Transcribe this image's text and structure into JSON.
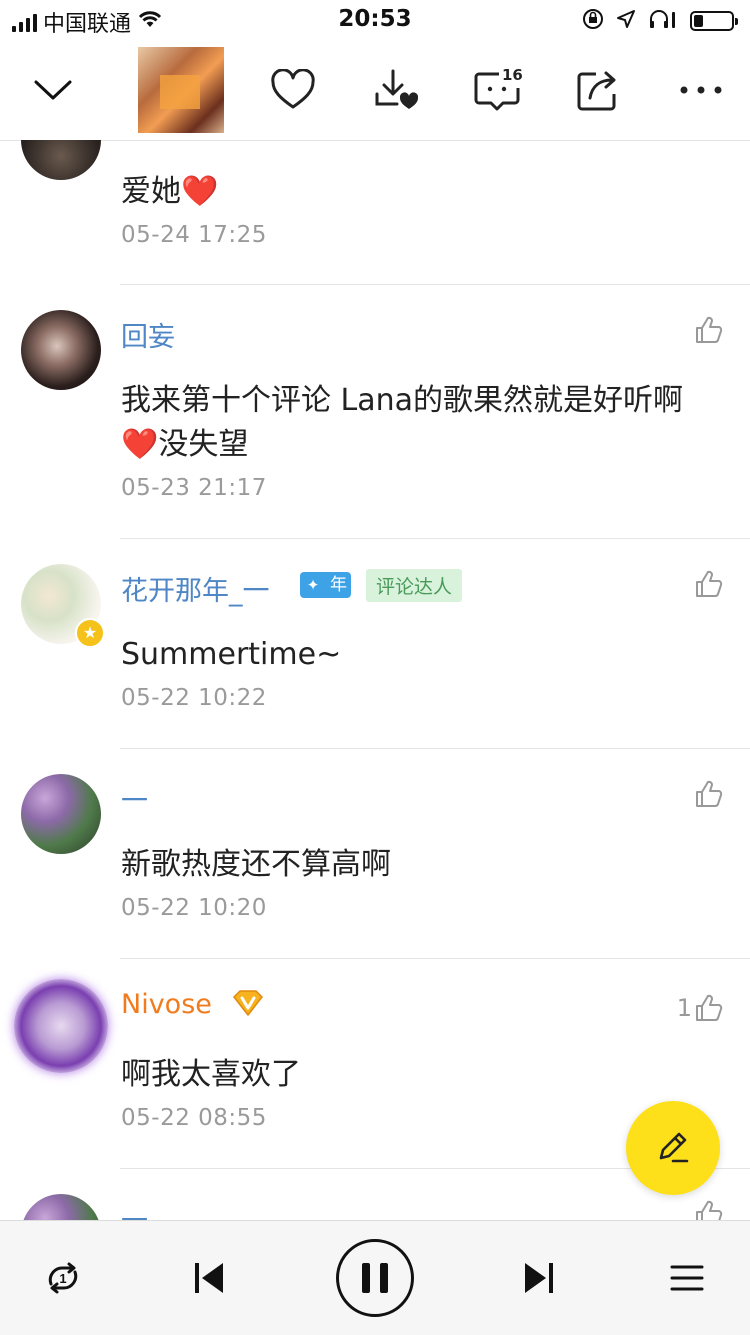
{
  "status_bar": {
    "carrier": "中国联通",
    "time": "20:53",
    "battery_level": 0.25
  },
  "toolbar": {
    "comment_count": "16"
  },
  "comments": [
    {
      "name": "",
      "text": "爱她",
      "text_suffix": "❤️",
      "time": "05-24 17:25",
      "likes": ""
    },
    {
      "name": "回妄",
      "text": "我来第十个评论   Lana的歌果然就是好听啊",
      "text_line2": "没失望",
      "text_line2_prefix": "❤️",
      "time": "05-23 21:17",
      "likes": ""
    },
    {
      "name": "花开那年_一",
      "year_badge": "年",
      "tag": "评论达人",
      "text": "Summertime~",
      "time": "05-22 10:22",
      "likes": ""
    },
    {
      "name": "一",
      "text": "新歌热度还不算高啊",
      "time": "05-22 10:20",
      "likes": ""
    },
    {
      "name": "Nivose",
      "vip_badge": "V",
      "text": "啊我太喜欢了",
      "time": "05-22 08:55",
      "likes": "1"
    },
    {
      "name": "一",
      "text": "",
      "time": "",
      "likes": ""
    }
  ],
  "colors": {
    "name_blue": "#4f86c6",
    "name_orange": "#f07c1f",
    "fab_yellow": "#fde01a"
  }
}
